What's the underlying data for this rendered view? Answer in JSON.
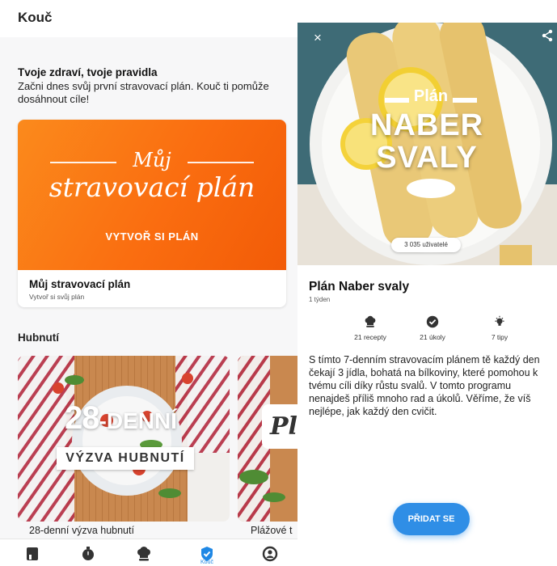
{
  "left": {
    "app_title": "Kouč",
    "intro_heading": "Tvoje zdraví, tvoje pravidla",
    "intro_text": "Začni dnes svůj první stravovací plán. Kouč ti pomůže dosáhnout cíle!",
    "plan_card": {
      "banner_line1": "Můj",
      "banner_line2": "stravovací plán",
      "banner_cta": "VYTVOŘ SI PLÁN",
      "name": "Můj stravovací plán",
      "subtitle": "Vytvoř si svůj plán"
    },
    "section_heading": "Hubnutí",
    "challenges": [
      {
        "big": "28",
        "dash": "-DENNÍ",
        "sub": "VÝZVA HUBNUTÍ",
        "label": "28-denní výzva hubnutí"
      },
      {
        "logo": "Pl",
        "label": "Plážové t"
      }
    ],
    "bottom_nav": {
      "active_label": "Kouč",
      "accent": "#1f88e5",
      "icon_color": "#333333"
    }
  },
  "right": {
    "close_glyph": "×",
    "hero": {
      "plan_word": "Plán",
      "big_line1": "NABER",
      "big_line2": "SVALY",
      "users": "3 035 uživatelé"
    },
    "title": "Plán Naber svaly",
    "duration": "1 týden",
    "stats": [
      {
        "icon": "chef-hat-icon",
        "label": "21 recepty"
      },
      {
        "icon": "check-circle-icon",
        "label": "21 úkoly"
      },
      {
        "icon": "lightbulb-icon",
        "label": "7 tipy"
      }
    ],
    "description": "S tímto 7-denním stravovacím plánem tě každý den čekají 3 jídla, bohatá na bílkoviny, které pomohou k tvému cíli díky růstu svalů. V tomto programu nenajdeš příliš mnoho rad a úkolů. Věříme, že víš nejlépe, jak každý den cvičit.",
    "join_button": "PŘIDAT SE",
    "accent": "#2f8ee6"
  }
}
